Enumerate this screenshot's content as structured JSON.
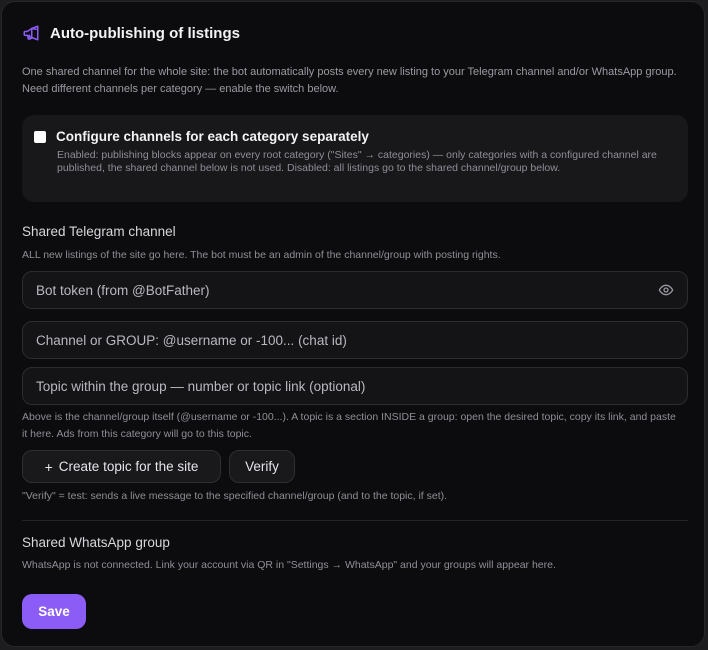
{
  "header": {
    "icon": "megaphone-icon",
    "title": "Auto-publishing of listings",
    "accent": "#8b5cf6"
  },
  "intro": "One shared channel for the whole site: the bot automatically posts every new listing to your Telegram channel and/or WhatsApp group. Need different channels per category — enable the switch below.",
  "category_toggle": {
    "checked": false,
    "label": "Configure channels for each category separately",
    "hint": "Enabled: publishing blocks appear on every root category (\"Sites\" → categories) — only categories with a configured channel are published, the shared channel below is not used. Disabled: all listings go to the shared channel/group below."
  },
  "telegram": {
    "title": "Shared Telegram channel",
    "description": "ALL new listings of the site go here. The bot must be an admin of the channel/group with posting rights.",
    "bot_token_placeholder": "Bot token (from @BotFather)",
    "channel_placeholder": "Channel or GROUP: @username or -100... (chat id)",
    "topic_placeholder": "Topic within the group — number or topic link (optional)",
    "topic_hint": "Above is the channel/group itself (@username or -100...). A topic is a section INSIDE a group: open the desired topic, copy its link, and paste it here. Ads from this category will go to this topic.",
    "create_topic_label": "Create topic for the site",
    "verify_label": "Verify",
    "verify_hint": "\"Verify\" = test: sends a live message to the specified channel/group (and to the topic, if set)."
  },
  "whatsapp": {
    "title": "Shared WhatsApp group",
    "description": "WhatsApp is not connected. Link your account via QR in \"Settings → WhatsApp\" and your groups will appear here."
  },
  "save_label": "Save"
}
